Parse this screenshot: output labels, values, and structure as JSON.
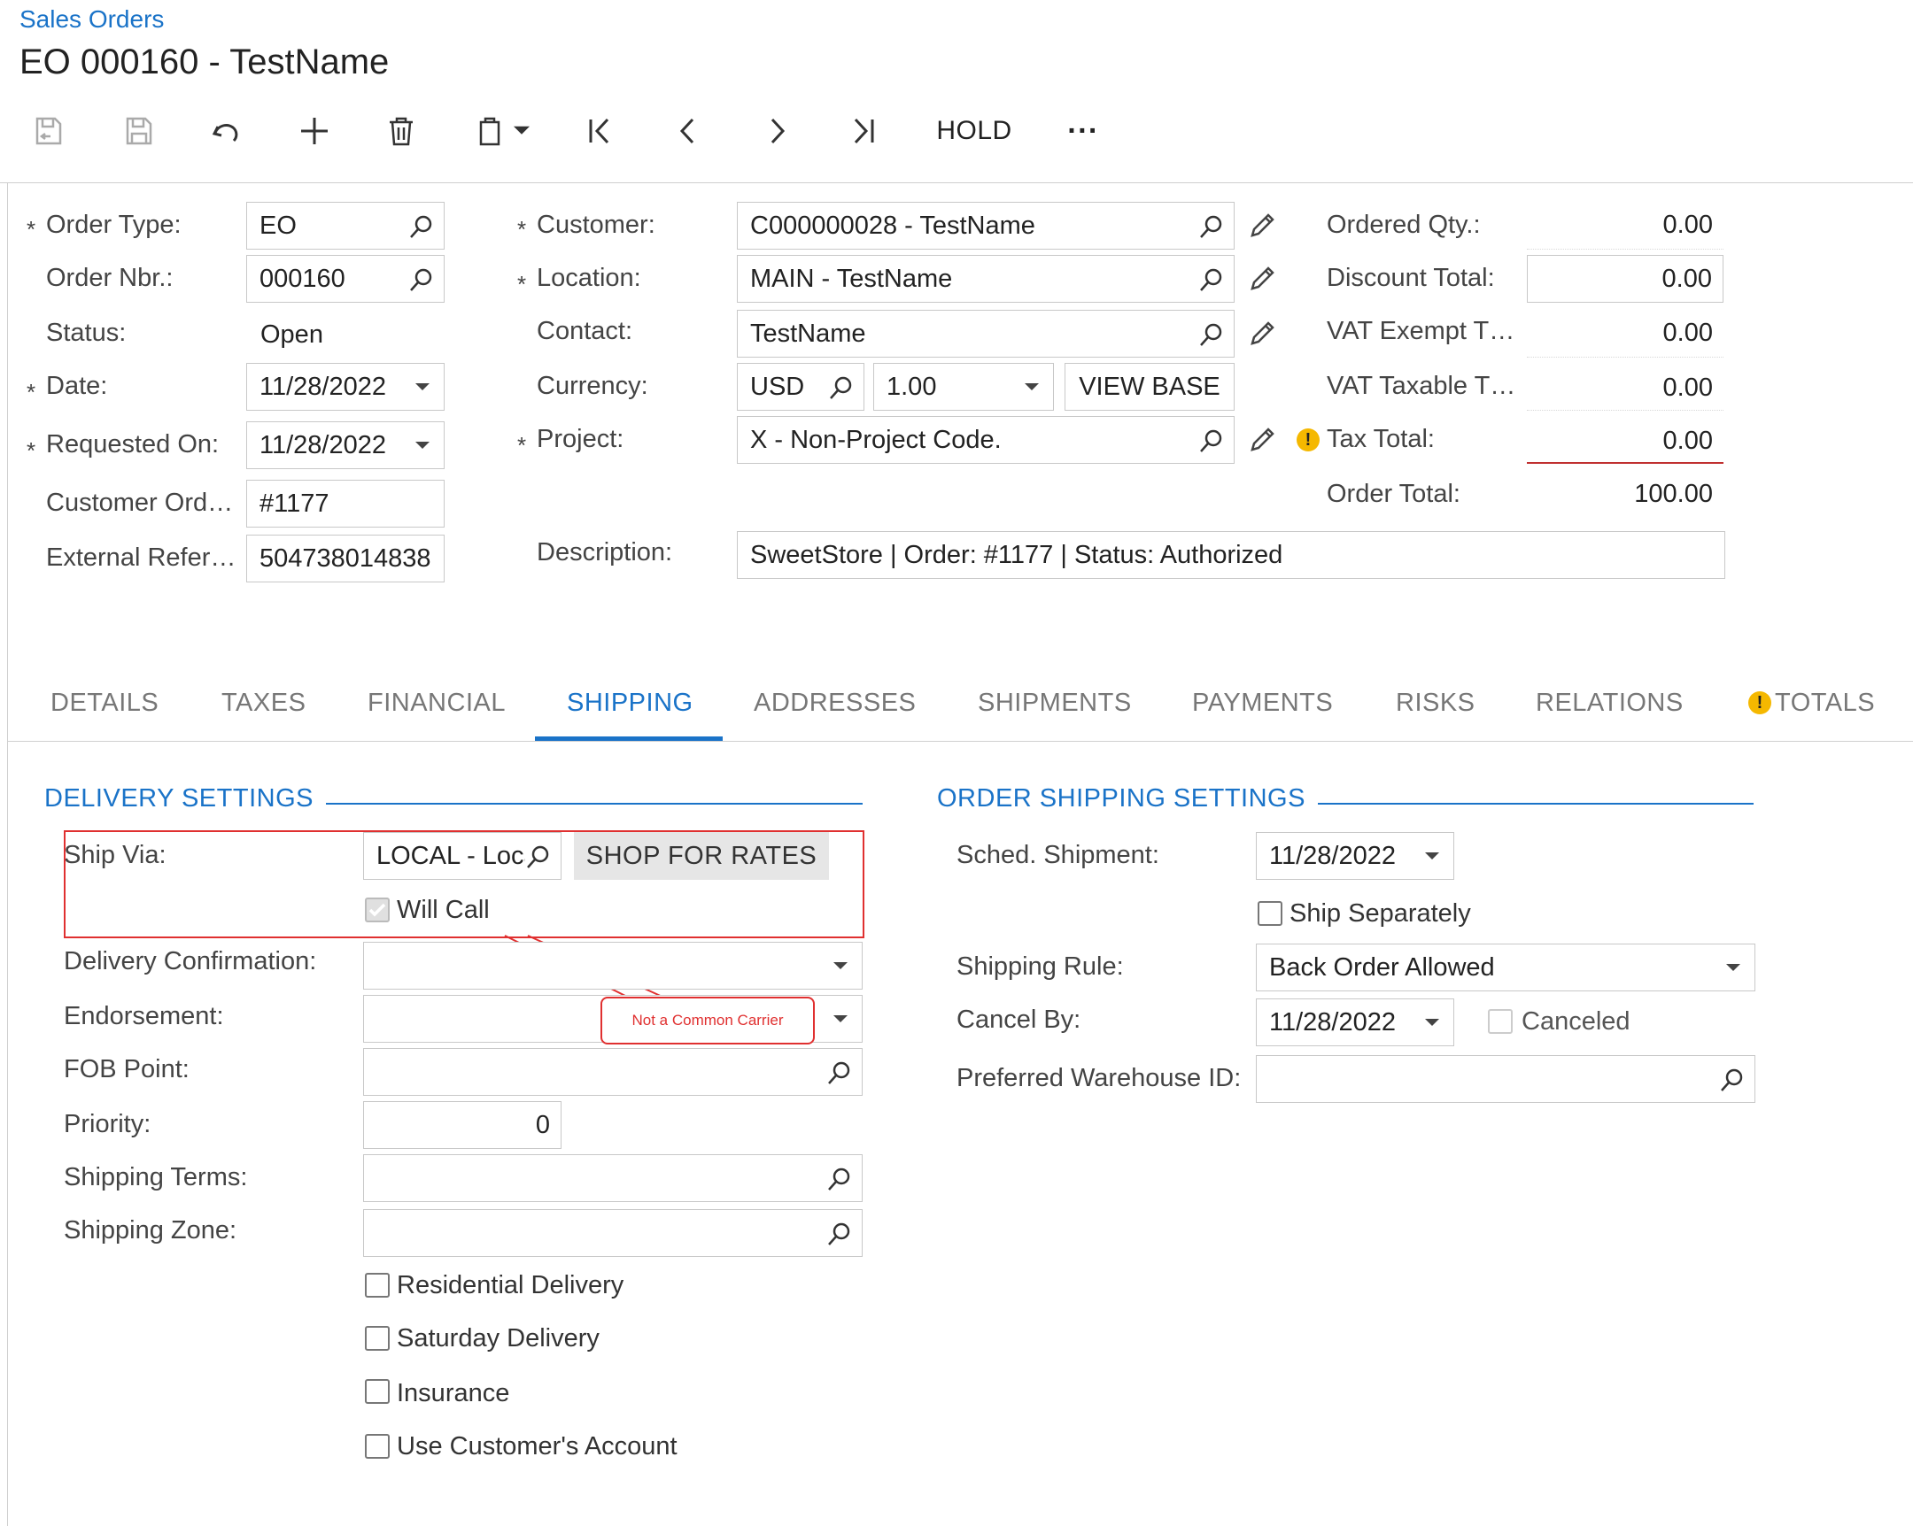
{
  "header": {
    "breadcrumb": "Sales Orders",
    "title": "EO 000160 - TestName"
  },
  "toolbar": {
    "hold_label": "HOLD",
    "more_label": "···"
  },
  "form": {
    "order_type": {
      "label": "Order Type:",
      "value": "EO"
    },
    "order_nbr": {
      "label": "Order Nbr.:",
      "value": "000160"
    },
    "status": {
      "label": "Status:",
      "value": "Open"
    },
    "date": {
      "label": "Date:",
      "value": "11/28/2022"
    },
    "requested_on": {
      "label": "Requested On:",
      "value": "11/28/2022"
    },
    "customer_ord": {
      "label": "Customer Ord…",
      "value": "#1177"
    },
    "external_ref": {
      "label": "External Refer…",
      "value": "504738014838"
    },
    "customer": {
      "label": "Customer:",
      "value": "C000000028 - TestName"
    },
    "location": {
      "label": "Location:",
      "value": "MAIN - TestName"
    },
    "contact": {
      "label": "Contact:",
      "value": "TestName"
    },
    "currency": {
      "label": "Currency:",
      "code": "USD",
      "rate": "1.00",
      "view_base": "VIEW BASE"
    },
    "project": {
      "label": "Project:",
      "value": "X - Non-Project Code."
    },
    "description": {
      "label": "Description:",
      "value": "SweetStore | Order: #1177 | Status: Authorized"
    },
    "ordered_qty": {
      "label": "Ordered Qty.:",
      "value": "0.00"
    },
    "discount_total": {
      "label": "Discount Total:",
      "value": "0.00"
    },
    "vat_exempt": {
      "label": "VAT Exempt T…",
      "value": "0.00"
    },
    "vat_taxable": {
      "label": "VAT Taxable T…",
      "value": "0.00"
    },
    "tax_total": {
      "label": "Tax Total:",
      "value": "0.00"
    },
    "order_total": {
      "label": "Order Total:",
      "value": "100.00"
    },
    "required_mark": "*"
  },
  "tabs": [
    {
      "label": "DETAILS"
    },
    {
      "label": "TAXES"
    },
    {
      "label": "FINANCIAL"
    },
    {
      "label": "SHIPPING"
    },
    {
      "label": "ADDRESSES"
    },
    {
      "label": "SHIPMENTS"
    },
    {
      "label": "PAYMENTS"
    },
    {
      "label": "RISKS"
    },
    {
      "label": "RELATIONS"
    },
    {
      "label": "TOTALS"
    }
  ],
  "active_tab": "SHIPPING",
  "delivery": {
    "title": "DELIVERY SETTINGS",
    "ship_via": {
      "label": "Ship Via:",
      "value": "LOCAL - Local"
    },
    "shop_for_rates": "SHOP FOR RATES",
    "will_call": {
      "label": "Will Call",
      "checked": true
    },
    "delivery_confirmation": {
      "label": "Delivery Confirmation:",
      "value": ""
    },
    "endorsement": {
      "label": "Endorsement:",
      "value": ""
    },
    "fob_point": {
      "label": "FOB Point:",
      "value": ""
    },
    "priority": {
      "label": "Priority:",
      "value": "0"
    },
    "shipping_terms": {
      "label": "Shipping Terms:",
      "value": ""
    },
    "shipping_zone": {
      "label": "Shipping Zone:",
      "value": ""
    },
    "residential": {
      "label": "Residential Delivery",
      "checked": false
    },
    "saturday": {
      "label": "Saturday Delivery",
      "checked": false
    },
    "insurance": {
      "label": "Insurance",
      "checked": false
    },
    "use_customer_account": {
      "label": "Use Customer's Account",
      "checked": false
    }
  },
  "annotation": {
    "text": "Not a Common Carrier",
    "color": "#e03030"
  },
  "order_shipping": {
    "title": "ORDER SHIPPING SETTINGS",
    "sched_shipment": {
      "label": "Sched. Shipment:",
      "value": "11/28/2022"
    },
    "ship_separately": {
      "label": "Ship Separately",
      "checked": false
    },
    "shipping_rule": {
      "label": "Shipping Rule:",
      "value": "Back Order Allowed"
    },
    "cancel_by": {
      "label": "Cancel By:",
      "value": "11/28/2022"
    },
    "canceled": {
      "label": "Canceled",
      "checked": false
    },
    "preferred_warehouse": {
      "label": "Preferred Warehouse ID:",
      "value": ""
    }
  },
  "colors": {
    "accent": "#1a73c8",
    "warning": "#f5b800",
    "annotation": "#e03030"
  }
}
